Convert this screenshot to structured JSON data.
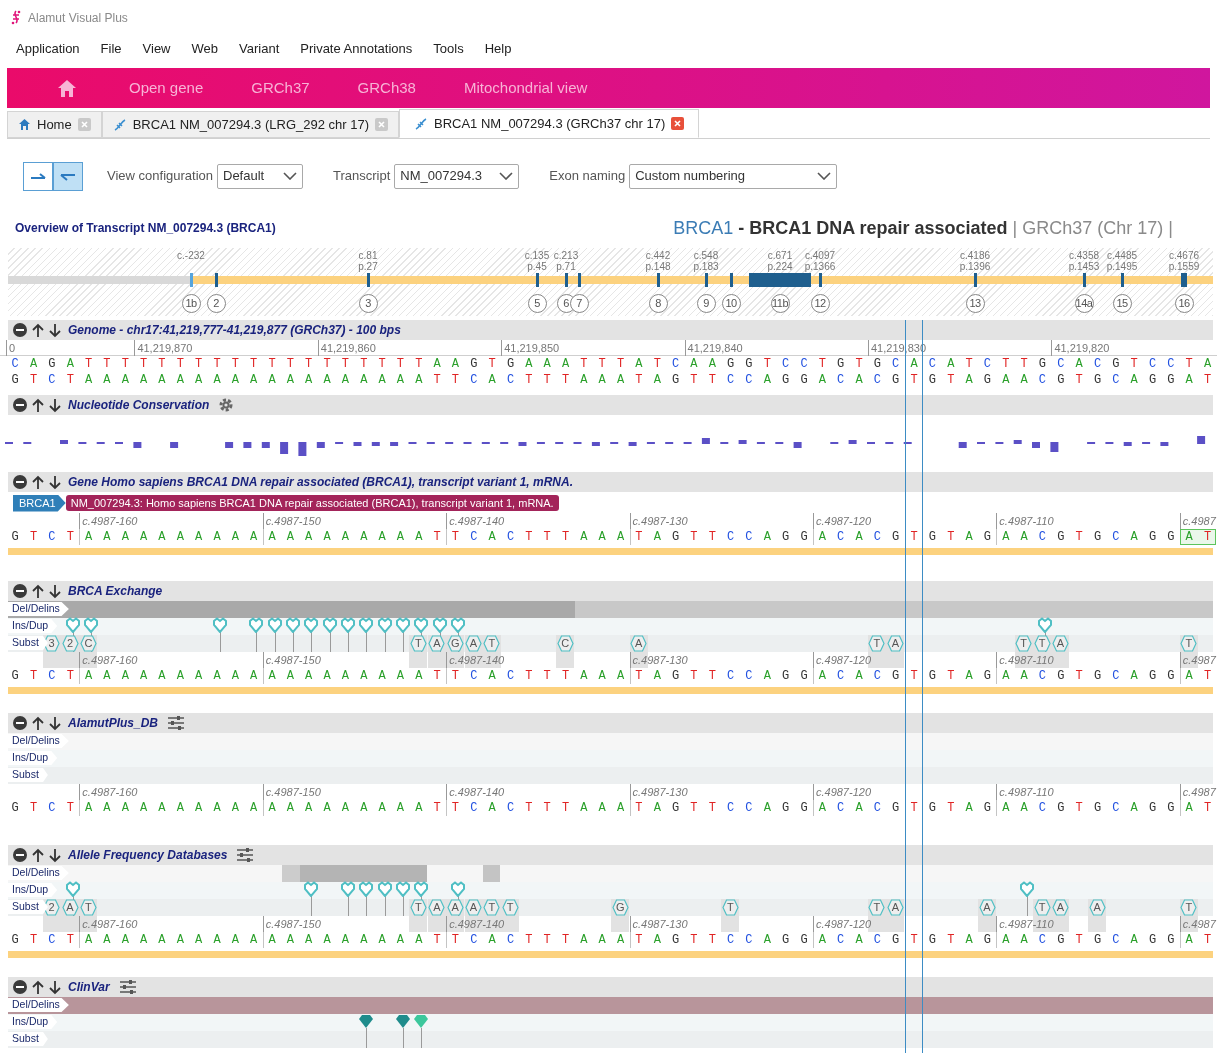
{
  "app": {
    "title": "Alamut Visual Plus"
  },
  "menu": [
    "Application",
    "File",
    "View",
    "Web",
    "Variant",
    "Private Annotations",
    "Tools",
    "Help"
  ],
  "nav": [
    "Open gene",
    "GRCh37",
    "GRCh38",
    "Mitochondrial view"
  ],
  "tabs": [
    {
      "label": "Home",
      "selected": false
    },
    {
      "label": "BRCA1 NM_007294.3 (LRG_292 chr 17)",
      "selected": false
    },
    {
      "label": "BRCA1 NM_007294.3 (GRCh37 chr 17)",
      "selected": true
    }
  ],
  "toolbar": {
    "strand_buttons": [
      {
        "selected": false
      },
      {
        "selected": true
      }
    ],
    "fields": [
      {
        "label": "View configuration",
        "value": "Default"
      },
      {
        "label": "Transcript",
        "value": "NM_007294.3"
      },
      {
        "label": "Exon naming",
        "value": "Custom numbering"
      }
    ]
  },
  "overview": {
    "title": "Overview of Transcript NM_007294.3 (BRCA1)",
    "exons": [
      {
        "number": "1b",
        "c_label": "c.-232",
        "coding": false
      },
      {
        "number": "2",
        "coding": true
      },
      {
        "number": "3",
        "c_label": "c.81",
        "p_label": "p.27",
        "coding": true
      },
      {
        "number": "5",
        "c_label": "c.135",
        "p_label": "p.45",
        "coding": true
      },
      {
        "number": "6",
        "c_label": "c.213",
        "p_label": "p.71",
        "coding": true
      },
      {
        "number": "7",
        "coding": true
      },
      {
        "number": "8",
        "c_label": "c.442",
        "p_label": "p.148",
        "coding": true
      },
      {
        "number": "9",
        "c_label": "c.548",
        "p_label": "p.183",
        "coding": true
      },
      {
        "number": "10",
        "coding": true
      },
      {
        "number": "11b",
        "c_label": "c.671",
        "p_label": "p.224",
        "coding": true
      },
      {
        "number": "12",
        "c_label": "c.4097",
        "p_label": "p.1366",
        "coding": true
      },
      {
        "number": "13",
        "c_label": "c.4186",
        "p_label": "p.1396",
        "coding": true
      },
      {
        "number": "14a",
        "c_label": "c.4358",
        "p_label": "p.1453",
        "coding": true
      },
      {
        "number": "15",
        "c_label": "c.4485",
        "p_label": "p.1495",
        "coding": true
      },
      {
        "number": "16",
        "c_label": "c.4676",
        "p_label": "p.1559",
        "coding": true
      }
    ]
  },
  "gene_heading": {
    "symbol": "BRCA1",
    "name": " - BRCA1 DNA repair associated",
    "assembly": " | GRCh37 (Chr 17) |"
  },
  "tracks": [
    {
      "kind": "genome",
      "title": "Genome - chr17:41,219,777-41,219,877 (GRCh37) - 100 bps",
      "ruler": [
        "0",
        "41,219,870",
        "41,219,860",
        "41,219,850",
        "41,219,840",
        "41,219,830",
        "41,219,820"
      ],
      "sequences": [
        "CAGATTTTTTTTTTTTTTTTTTTAAGTGAAATTTATCAAGGTCCTGTGCACATCTTGCACGTCCTA",
        "GTCTAAAAAAAAAAAAAAAAAAATTCACTTTAAATAGTTCCAGGACACGTGTAGAACGTGCAGGAT"
      ]
    },
    {
      "kind": "conservation",
      "title": "Nucleotide Conservation",
      "settings": true
    },
    {
      "kind": "gene",
      "title": "Gene Homo sapiens BRCA1 DNA repair associated (BRCA1), transcript variant 1, mRNA.",
      "gene_tag": "BRCA1",
      "transcript_label": "NM_007294.3: Homo sapiens BRCA1 DNA repair associated (BRCA1), transcript variant 1, mRNA.",
      "ruler": [
        "c.4987-160",
        "c.4987-150",
        "c.4987-140",
        "c.4987-130",
        "c.4987-120",
        "c.4987-110",
        "c.4987"
      ],
      "sequence": "GTCTAAAAAAAAAAAAAAAAAAATTCACTTTAAATAGTTCCAGGACACGTGTAGAACGTGCAGGAT"
    },
    {
      "kind": "variants",
      "title": "BRCA Exchange",
      "settings": false,
      "lanes": [
        "Del/Delins",
        "Ins/Dup",
        "Subst"
      ],
      "ins_dup": [
        {
          "color": "#4fbfc4"
        },
        {
          "color": "#4fbfc4"
        },
        {
          "color": "#4fbfc4"
        },
        {
          "color": "#4fbfc4"
        },
        {
          "color": "#4fbfc4"
        },
        {
          "color": "#4fbfc4"
        },
        {
          "color": "#4fbfc4"
        },
        {
          "color": "#4fbfc4"
        },
        {
          "color": "#4fbfc4"
        },
        {
          "color": "#4fbfc4"
        },
        {
          "color": "#4fbfc4"
        },
        {
          "color": "#4fbfc4"
        },
        {
          "color": "#4fbfc4"
        },
        {
          "color": "#4fbfc4"
        },
        {
          "color": "#4fbfc4"
        },
        {
          "color": "#4fbfc4"
        }
      ],
      "subst": [
        "3",
        "2",
        "C",
        "T",
        "A",
        "G",
        "A",
        "T",
        "C",
        "A",
        "T",
        "A",
        "T",
        "T",
        "A",
        "T"
      ],
      "ruler": [
        "c.4987-160",
        "c.4987-150",
        "c.4987-140",
        "c.4987-130",
        "c.4987-120",
        "c.4987-110",
        "c.4987"
      ],
      "sequence": "GTCTAAAAAAAAAAAAAAAAAAATTCACTTTAAATAGTTCCAGGACACGTGTAGAACGTGCAGGAT",
      "coverage_bar": true
    },
    {
      "kind": "variants",
      "title": "AlamutPlus_DB",
      "settings": true,
      "lanes": [
        "Del/Delins",
        "Ins/Dup",
        "Subst"
      ],
      "ruler": [
        "c.4987-160",
        "c.4987-150",
        "c.4987-140",
        "c.4987-130",
        "c.4987-120",
        "c.4987-110",
        "c.4987"
      ],
      "sequence": "GTCTAAAAAAAAAAAAAAAAAAATTCACTTTAAATAGTTCCAGGACACGTGTAGAACGTGCAGGAT",
      "coverage_bar": false
    },
    {
      "kind": "variants",
      "title": "Allele Frequency Databases",
      "settings": true,
      "lanes": [
        "Del/Delins",
        "Ins/Dup",
        "Subst"
      ],
      "ins_dup": [
        {
          "color": "#4fbfc4"
        },
        {
          "color": "#4fbfc4"
        },
        {
          "color": "#4fbfc4"
        },
        {
          "color": "#4fbfc4"
        },
        {
          "color": "#4fbfc4"
        },
        {
          "color": "#4fbfc4"
        },
        {
          "color": "#4fbfc4"
        },
        {
          "color": "#4fbfc4"
        },
        {
          "color": "#4fbfc4"
        }
      ],
      "subst": [
        "2",
        "A",
        "T",
        "T",
        "A",
        "A",
        "A",
        "T",
        "T",
        "G",
        "T",
        "T",
        "A",
        "A",
        "T",
        "A",
        "A",
        "T"
      ],
      "ruler": [
        "c.4987-160",
        "c.4987-150",
        "c.4987-140",
        "c.4987-130",
        "c.4987-120",
        "c.4987-110",
        "c.4987"
      ],
      "sequence": "GTCTAAAAAAAAAAAAAAAAAAATTCACTTTAAATAGTTCCAGGACACGTGTAGAACGTGCAGGAT",
      "coverage_bar": true
    },
    {
      "kind": "clinical_variants",
      "title": "ClinVar",
      "settings": true,
      "lanes": [
        "Del/Delins",
        "Ins/Dup",
        "Subst"
      ],
      "ins_dup": [
        {
          "color": "#1f8c8c"
        },
        {
          "color": "#1f8c8c"
        },
        {
          "color": "#3cc79c"
        }
      ]
    }
  ]
}
